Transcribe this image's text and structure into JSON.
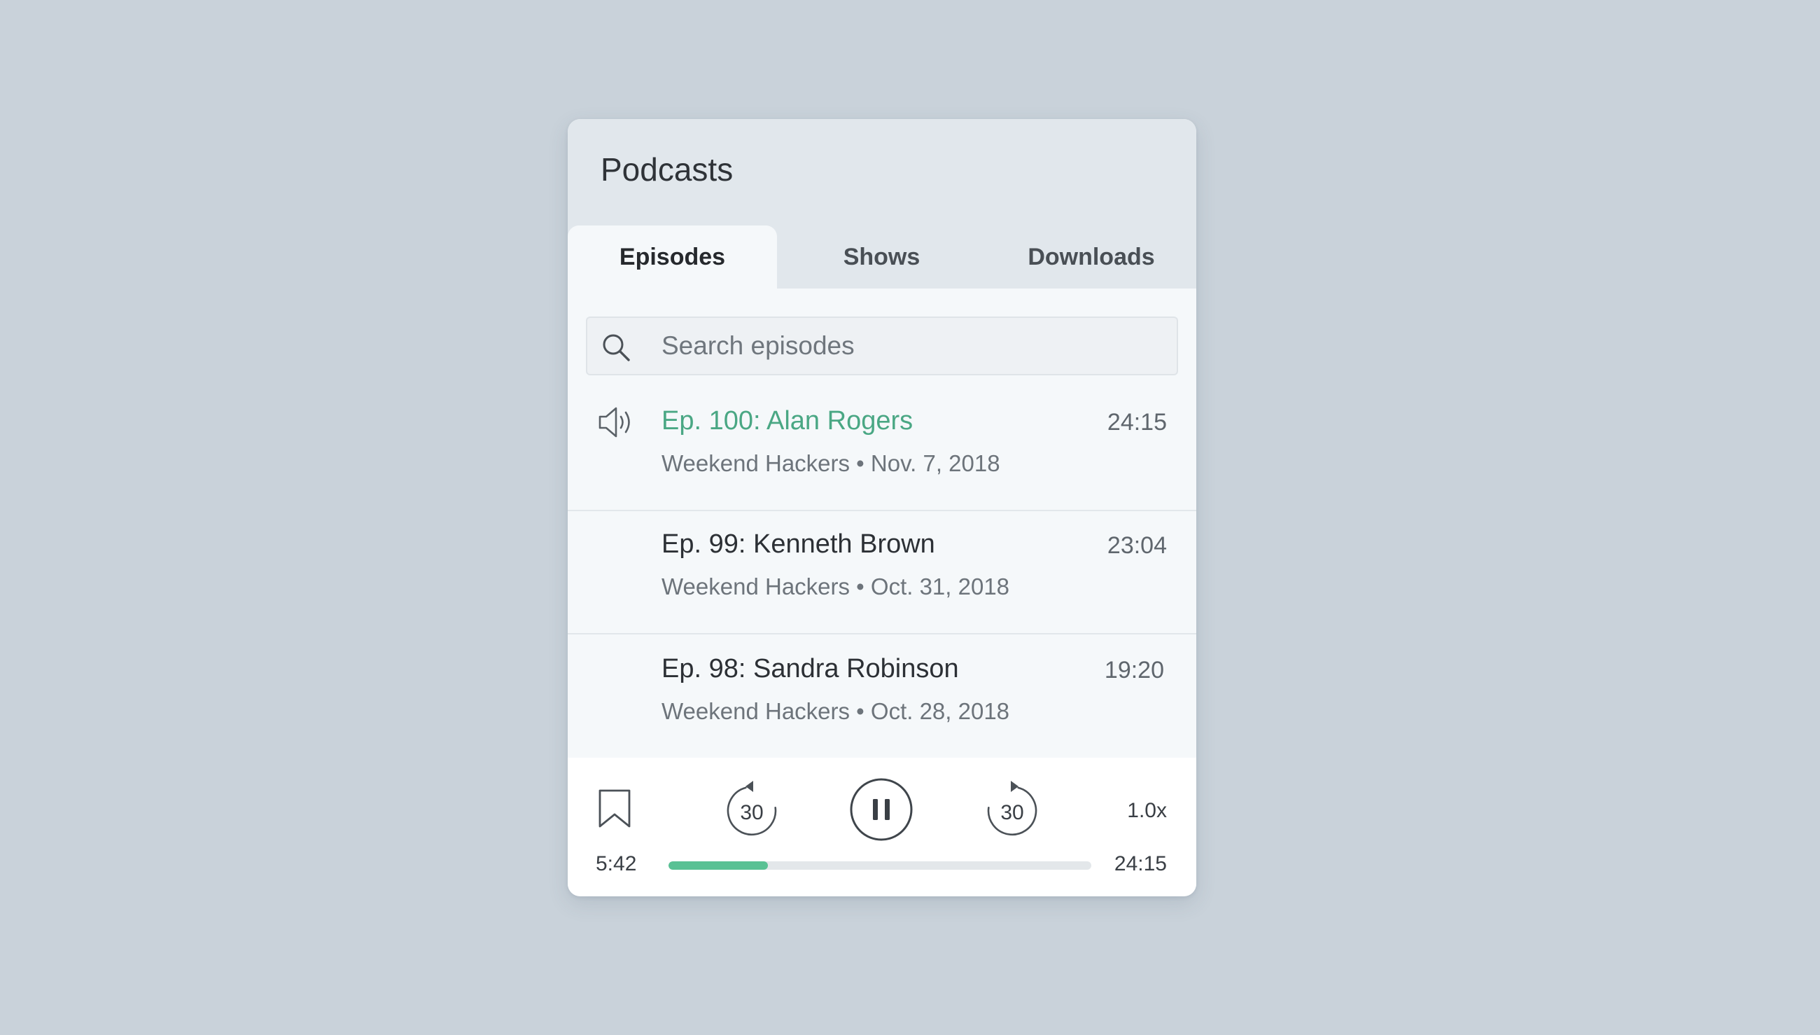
{
  "app": {
    "title": "Podcasts"
  },
  "tabs": [
    {
      "label": "Episodes",
      "active": true
    },
    {
      "label": "Shows",
      "active": false
    },
    {
      "label": "Downloads",
      "active": false
    }
  ],
  "search": {
    "placeholder": "Search episodes",
    "value": ""
  },
  "episodes": [
    {
      "title": "Ep. 100: Alan Rogers",
      "show": "Weekend Hackers",
      "date": "Nov. 7, 2018",
      "meta": "Weekend Hackers • Nov. 7, 2018",
      "duration": "24:15",
      "playing": true
    },
    {
      "title": "Ep. 99: Kenneth Brown",
      "show": "Weekend Hackers",
      "date": "Oct. 31, 2018",
      "meta": "Weekend Hackers • Oct. 31, 2018",
      "duration": "23:04",
      "playing": false
    },
    {
      "title": "Ep. 98: Sandra Robinson",
      "show": "Weekend Hackers",
      "date": "Oct. 28, 2018",
      "meta": "Weekend Hackers • Oct. 28, 2018",
      "duration": "19:20",
      "playing": false
    }
  ],
  "player": {
    "rewind_label": "30",
    "forward_label": "30",
    "speed": "1.0x",
    "elapsed": "5:42",
    "total": "24:15",
    "progress_fraction": 0.235
  },
  "icons": {
    "search": "search-icon",
    "playing": "speaker-icon",
    "bookmark": "bookmark-icon",
    "rewind": "rewind-30-icon",
    "pause": "pause-icon",
    "forward": "forward-30-icon"
  },
  "colors": {
    "background": "#c9d2da",
    "header": "#e1e7ec",
    "accent": "#4aa784",
    "progress": "#59c194",
    "text": "#2c3035"
  }
}
